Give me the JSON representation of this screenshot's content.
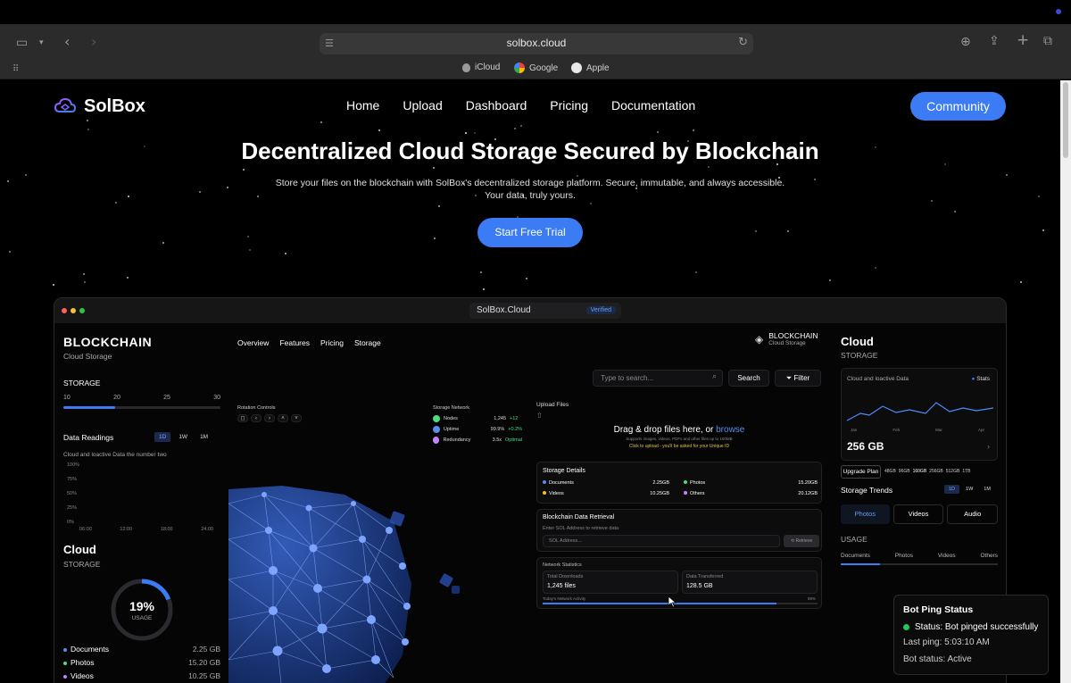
{
  "browser": {
    "url": "solbox.cloud",
    "favorites": [
      {
        "label": "iCloud",
        "icon_color": "#9a9a9a"
      },
      {
        "label": "Google",
        "icon_color": "#e8e8e8"
      },
      {
        "label": "Apple",
        "icon_color": "#e8e8e8"
      }
    ]
  },
  "brand": {
    "name": "SolBox",
    "accent": "#3b7cf4"
  },
  "nav": {
    "items": [
      "Home",
      "Upload",
      "Dashboard",
      "Pricing",
      "Documentation"
    ],
    "community_label": "Community"
  },
  "hero": {
    "title": "Decentralized Cloud Storage Secured by Blockchain",
    "subtitle_line1": "Store your files on the blockchain with SolBox's decentralized storage platform. Secure, immutable, and always accessible.",
    "subtitle_line2": "Your data, truly yours.",
    "cta_label": "Start Free Trial"
  },
  "app": {
    "title": "SolBox.Cloud",
    "verified": "Verified",
    "left": {
      "heading": "BLOCKCHAIN",
      "subheading": "Cloud Storage",
      "storage_label": "STORAGE",
      "storage_ticks": [
        "10",
        "20",
        "25",
        "30"
      ],
      "storage_fill": 0.33,
      "readings_label": "Data Readings",
      "ranges": [
        "1D",
        "1W",
        "1M"
      ],
      "readings_caption": "Cloud and loactive Data the number two",
      "y_ticks": [
        "100%",
        "75%",
        "50%",
        "25%",
        "0%"
      ],
      "x_ticks": [
        "06:00",
        "12:00",
        "18:00",
        "24:00"
      ],
      "cloud_heading": "Cloud",
      "cloud_sub": "STORAGE",
      "usage_value": "19%",
      "usage_label": "USAGE",
      "usage_fraction": 0.19,
      "files": [
        {
          "name": "Documents",
          "size": "2.25 GB",
          "color": "#5b8def"
        },
        {
          "name": "Photos",
          "size": "15.20 GB",
          "color": "#4ade80"
        },
        {
          "name": "Videos",
          "size": "10.25 GB",
          "color": "#c084fc"
        }
      ]
    },
    "center": {
      "tabs": [
        "Overview",
        "Features",
        "Pricing",
        "Storage"
      ],
      "rotation_label": "Rotation Controls",
      "rotation_buttons": [
        "◻",
        "‹",
        "›",
        "˄",
        "˅"
      ],
      "network_label": "Storage Network",
      "network": [
        {
          "label": "Nodes",
          "value": "1,245",
          "delta": "+12",
          "color": "#4ade80"
        },
        {
          "label": "Uptime",
          "value": "99.9%",
          "delta": "+0.2%",
          "color": "#5b8def"
        },
        {
          "label": "Redundancy",
          "value": "3.5x",
          "delta": "Optimal",
          "color": "#c084fc"
        }
      ],
      "brand_heading": "BLOCKCHAIN",
      "brand_sub": "Cloud Storage",
      "search_placeholder": "Type to search...",
      "search_label": "Search",
      "filter_label": "Filter",
      "upload_label": "Upload Files",
      "drop_text": "Drag & drop files here, or",
      "browse_label": "browse",
      "drop_hint": "Supports images, videos, PDFs and other files up to 100MB",
      "drop_note": "Click to upload - you'll be asked for your Unique ID",
      "details_label": "Storage Details",
      "details": [
        {
          "name": "Documents",
          "size": "2.25GB",
          "color": "#5b8def"
        },
        {
          "name": "Photos",
          "size": "15.20GB",
          "color": "#4ade80"
        },
        {
          "name": "Videos",
          "size": "10.25GB",
          "color": "#fbbf24"
        },
        {
          "name": "Others",
          "size": "20.12GB",
          "color": "#c084fc"
        }
      ],
      "retrieval_label": "Blockchain Data Retrieval",
      "retrieval_hint": "Enter SOL Address to retrieve data",
      "sol_placeholder": "SOL Address...",
      "retrieve_label": "Retrieve",
      "stats_label": "Network Statistics",
      "downloads_label": "Total Downloads",
      "downloads_value": "1,245 files",
      "transferred_label": "Data Transferred",
      "transferred_value": "128.5 GB",
      "activity_label": "Today's Network Activity",
      "activity_value": "85%",
      "activity_fraction": 0.85
    },
    "right": {
      "heading": "Cloud",
      "sub": "STORAGE",
      "card_label": "Cloud and loactive Data",
      "stats_label": "Stats",
      "months": [
        "Jan",
        "Feb",
        "Mar",
        "Apr"
      ],
      "capacity": "256 GB",
      "upgrade_label": "Upgrade Plan",
      "plans": [
        "48GB",
        "96GB",
        "160GB",
        "256GB",
        "512GB",
        "1TB"
      ],
      "trends_label": "Storage Trends",
      "ranges": [
        "1D",
        "1W",
        "1M"
      ],
      "media_tabs": [
        "Photos",
        "Videos",
        "Audio"
      ],
      "usage_label": "USAGE",
      "usage_tabs": [
        "Documents",
        "Photos",
        "Videos",
        "Others"
      ]
    }
  },
  "toast": {
    "title": "Bot Ping Status",
    "status": "Status: Bot pinged successfully",
    "last_ping": "Last ping: 5:03:10 AM",
    "bot_status": "Bot status: Active",
    "status_color": "#22c55e"
  }
}
